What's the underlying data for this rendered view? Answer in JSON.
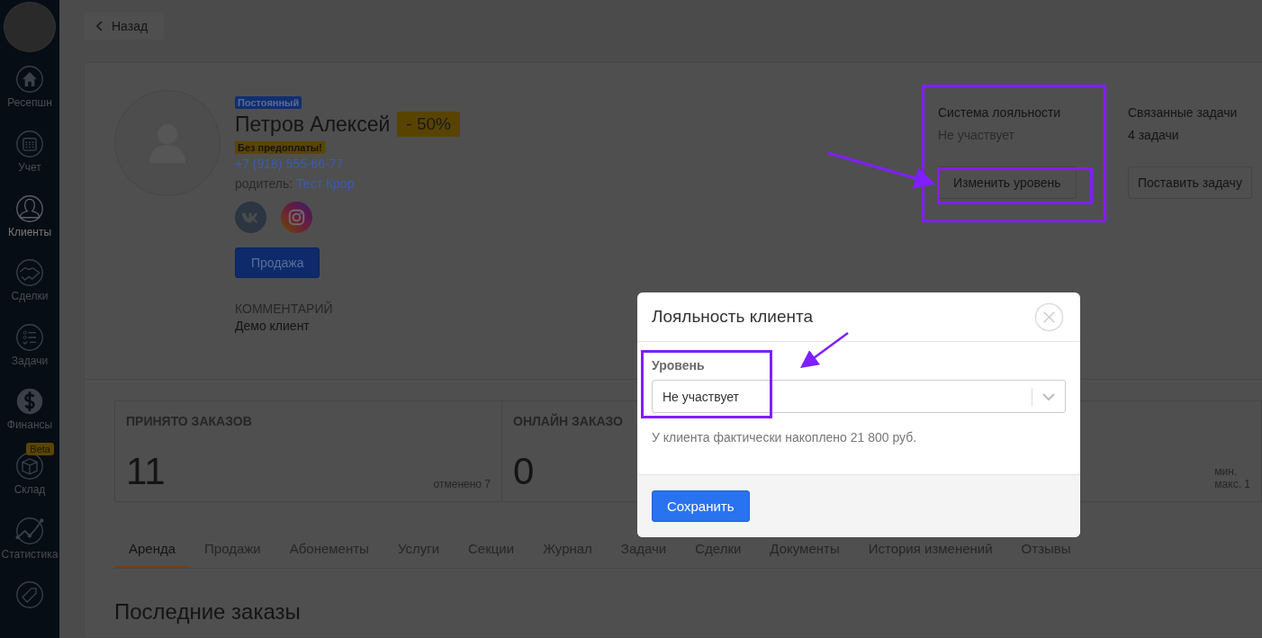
{
  "sidebar": {
    "items": [
      {
        "label": "Ресепшн",
        "selected": false
      },
      {
        "label": "Учет",
        "selected": false
      },
      {
        "label": "Клиенты",
        "selected": true
      },
      {
        "label": "Сделки",
        "selected": false
      },
      {
        "label": "Задачи",
        "selected": false
      },
      {
        "label": "Финансы",
        "selected": false
      },
      {
        "label": "Склад",
        "selected": false,
        "badge": "Beta"
      },
      {
        "label": "Статистика",
        "selected": false
      },
      {
        "selected": false
      }
    ]
  },
  "back_button": "Назад",
  "client": {
    "status_badge": "Постоянный",
    "name": "Петров Алексей",
    "discount": "- 50%",
    "warning_badge": "Без предоплаты!",
    "phone": "+7 (918) 555-66-77",
    "parent_label": "родитель:",
    "parent_name": "Тест Крор",
    "sale_button": "Продажа",
    "comment_label": "КОММЕНТАРИЙ",
    "comment": "Демо клиент"
  },
  "loyalty": {
    "title": "Система лояльности",
    "value": "Не участвует",
    "button": "Изменить уровень"
  },
  "tasks": {
    "title": "Связанные задачи",
    "value": "4 задачи",
    "button": "Поставить задачу"
  },
  "stats": [
    {
      "label": "ПРИНЯТО ЗАКАЗОВ",
      "value": "11",
      "notes": [
        "отменено 7"
      ]
    },
    {
      "label": "ОНЛАЙН ЗАКАЗО",
      "value": "0"
    },
    {
      "notes": [
        "мин.",
        "макс. 1"
      ]
    }
  ],
  "tabs": [
    {
      "label": "Аренда",
      "selected": true
    },
    {
      "label": "Продажи",
      "selected": false
    },
    {
      "label": "Абонементы",
      "selected": false
    },
    {
      "label": "Услуги",
      "selected": false
    },
    {
      "label": "Секции",
      "selected": false
    },
    {
      "label": "Журнал",
      "selected": false
    },
    {
      "label": "Задачи",
      "selected": false
    },
    {
      "label": "Сделки",
      "selected": false
    },
    {
      "label": "Документы",
      "selected": false
    },
    {
      "label": "История изменений",
      "selected": false
    },
    {
      "label": "Отзывы",
      "selected": false
    }
  ],
  "section_title": "Последние заказы",
  "modal": {
    "title": "Лояльность клиента",
    "field_label": "Уровень",
    "field_value": "Не участвует",
    "note": "У клиента фактически накоплено 21 800 руб.",
    "save_button": "Сохранить"
  }
}
